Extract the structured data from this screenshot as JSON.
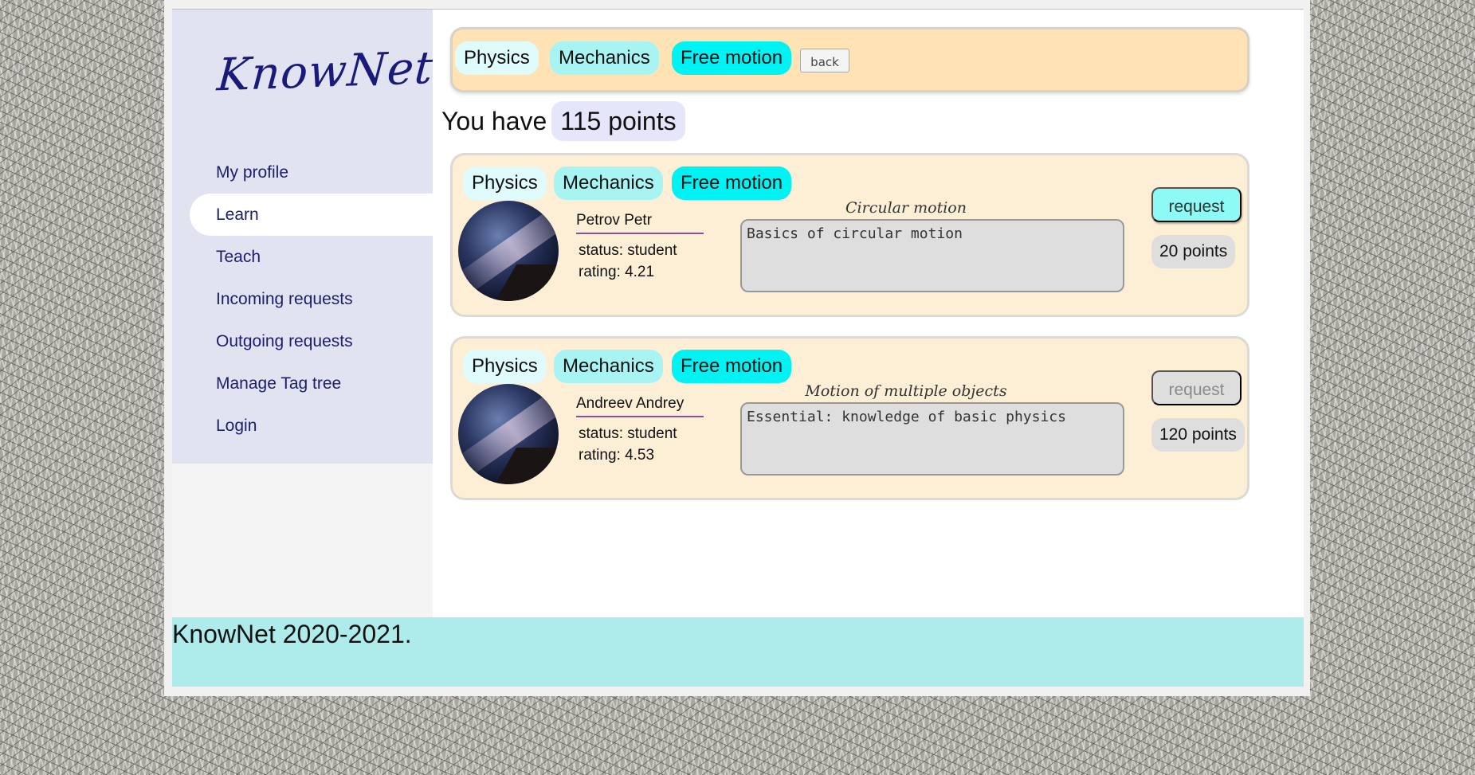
{
  "app": {
    "logo": "KnowNet"
  },
  "sidebar": {
    "items": [
      {
        "label": "My profile"
      },
      {
        "label": "Learn"
      },
      {
        "label": "Teach"
      },
      {
        "label": "Incoming requests"
      },
      {
        "label": "Outgoing requests"
      },
      {
        "label": "Manage Tag tree"
      },
      {
        "label": "Login"
      }
    ]
  },
  "breadcrumb": {
    "tags": [
      "Physics",
      "Mechanics",
      "Free motion"
    ],
    "back_label": "back"
  },
  "points": {
    "prefix": "You have",
    "value": "115 points"
  },
  "cards": [
    {
      "tags": [
        "Physics",
        "Mechanics",
        "Free motion"
      ],
      "name": "Petrov Petr",
      "status": "status: student",
      "rating": "rating:  4.21",
      "title": "Circular motion",
      "description": "Basics of circular motion",
      "request_label": "request",
      "request_enabled": true,
      "cost": "20 points"
    },
    {
      "tags": [
        "Physics",
        "Mechanics",
        "Free motion"
      ],
      "name": "Andreev Andrey",
      "status": "status: student",
      "rating": "rating:  4.53",
      "title": "Motion of multiple objects",
      "description": "Essential: knowledge of basic physics",
      "request_label": "request",
      "request_enabled": false,
      "cost": "120 points"
    }
  ],
  "footer": {
    "text": "KnowNet 2020-2021."
  },
  "colors": {
    "tag_level_1": "#e0fbfb",
    "tag_level_2": "#a8f4f2",
    "tag_level_3": "#00f3f3",
    "card_bg": "#fdefd6",
    "footer_bg": "#aeebeb",
    "nav_text": "#1d1d6e"
  }
}
